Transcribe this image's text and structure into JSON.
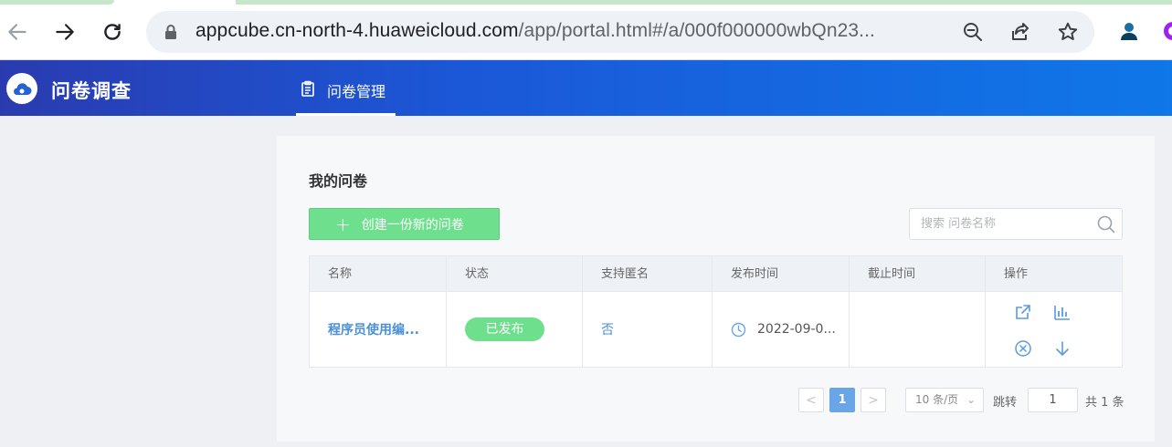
{
  "browser": {
    "url_host": "appcube.cn-north-4.huaweicloud.com",
    "url_path": "/app/portal.html#/a/000f000000wbQn23..."
  },
  "app": {
    "title": "问卷调查",
    "nav_tab_label": "问卷管理"
  },
  "main": {
    "section_title": "我的问卷",
    "create_button_label": "创建一份新的问卷",
    "search_placeholder": "搜索 问卷名称",
    "columns": [
      "名称",
      "状态",
      "支持匿名",
      "发布时间",
      "截止时间",
      "操作"
    ],
    "rows": [
      {
        "name": "程序员使用编...",
        "status": "已发布",
        "anonymous": "否",
        "publish_time": "2022-09-0...",
        "deadline": ""
      }
    ]
  },
  "pagination": {
    "prev": "<",
    "current_page": "1",
    "next": ">",
    "page_size": "10 条/页",
    "jump_label": "跳转",
    "jump_value": "1",
    "total_text": "共 1 条"
  },
  "colors": {
    "accent_green": "#6ee08d",
    "link_blue": "#4a8fd8",
    "header_gradient_start": "#2a3bb0",
    "header_gradient_end": "#0f77e8"
  },
  "icons": {
    "back": "arrow-left-icon",
    "forward": "arrow-right-icon",
    "reload": "reload-icon",
    "lock": "lock-icon",
    "zoom": "zoom-out-icon",
    "share": "share-icon",
    "bookmark": "star-icon",
    "ops": [
      "open-external-icon",
      "bar-chart-icon",
      "close-circle-icon",
      "download-icon"
    ]
  }
}
